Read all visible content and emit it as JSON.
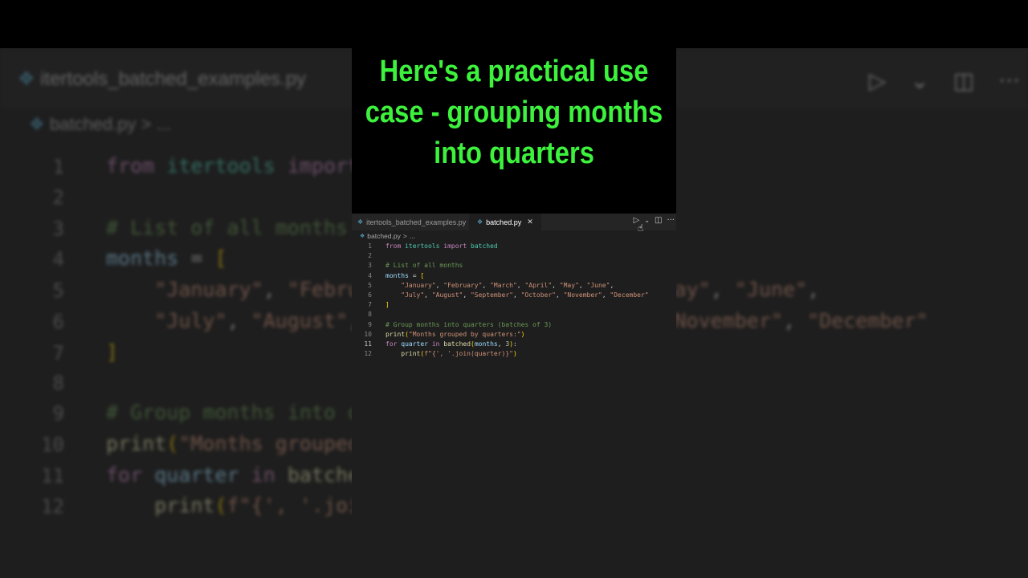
{
  "caption": "Here's a practical use case - grouping months into quarters",
  "tabs": [
    {
      "label": "itertools_batched_examples.py",
      "active": false
    },
    {
      "label": "batched.py",
      "active": true
    }
  ],
  "tab_close_glyph": "✕",
  "breadcrumb": {
    "file": "batched.py",
    "separator": ">",
    "rest": "..."
  },
  "actions": {
    "run": "▷",
    "dropdown": "⌄",
    "split": "◫",
    "more": "···"
  },
  "editor": {
    "current_line": 11,
    "lines": [
      {
        "n": "1",
        "tokens": [
          [
            "k",
            "from"
          ],
          [
            "p",
            " "
          ],
          [
            "n",
            "itertools"
          ],
          [
            "p",
            " "
          ],
          [
            "k",
            "import"
          ],
          [
            "p",
            " "
          ],
          [
            "n",
            "batched"
          ]
        ]
      },
      {
        "n": "2",
        "tokens": []
      },
      {
        "n": "3",
        "tokens": [
          [
            "c",
            "# List of all months"
          ]
        ]
      },
      {
        "n": "4",
        "tokens": [
          [
            "v",
            "months"
          ],
          [
            "p",
            " = "
          ],
          [
            "b",
            "["
          ]
        ]
      },
      {
        "n": "5",
        "tokens": [
          [
            "p",
            "    "
          ],
          [
            "s",
            "\"January\""
          ],
          [
            "p",
            ", "
          ],
          [
            "s",
            "\"February\""
          ],
          [
            "p",
            ", "
          ],
          [
            "s",
            "\"March\""
          ],
          [
            "p",
            ", "
          ],
          [
            "s",
            "\"April\""
          ],
          [
            "p",
            ", "
          ],
          [
            "s",
            "\"May\""
          ],
          [
            "p",
            ", "
          ],
          [
            "s",
            "\"June\""
          ],
          [
            "p",
            ","
          ]
        ]
      },
      {
        "n": "6",
        "tokens": [
          [
            "p",
            "    "
          ],
          [
            "s",
            "\"July\""
          ],
          [
            "p",
            ", "
          ],
          [
            "s",
            "\"August\""
          ],
          [
            "p",
            ", "
          ],
          [
            "s",
            "\"September\""
          ],
          [
            "p",
            ", "
          ],
          [
            "s",
            "\"October\""
          ],
          [
            "p",
            ", "
          ],
          [
            "s",
            "\"November\""
          ],
          [
            "p",
            ", "
          ],
          [
            "s",
            "\"December\""
          ]
        ]
      },
      {
        "n": "7",
        "tokens": [
          [
            "b",
            "]"
          ]
        ]
      },
      {
        "n": "8",
        "tokens": []
      },
      {
        "n": "9",
        "tokens": [
          [
            "c",
            "# Group months into quarters (batches of 3)"
          ]
        ]
      },
      {
        "n": "10",
        "tokens": [
          [
            "f",
            "print"
          ],
          [
            "b",
            "("
          ],
          [
            "s",
            "\"Months grouped by quarters:\""
          ],
          [
            "b",
            ")"
          ]
        ]
      },
      {
        "n": "11",
        "tokens": [
          [
            "k",
            "for"
          ],
          [
            "p",
            " "
          ],
          [
            "v",
            "quarter"
          ],
          [
            "p",
            " "
          ],
          [
            "k",
            "in"
          ],
          [
            "p",
            " "
          ],
          [
            "f",
            "batched"
          ],
          [
            "b",
            "("
          ],
          [
            "v",
            "months"
          ],
          [
            "p",
            ", "
          ],
          [
            "num",
            "3"
          ],
          [
            "b",
            ")"
          ],
          [
            "p",
            ":"
          ]
        ]
      },
      {
        "n": "12",
        "tokens": [
          [
            "p",
            "    "
          ],
          [
            "f",
            "print"
          ],
          [
            "b",
            "("
          ],
          [
            "s",
            "f\"{', '.join(quarter)}\""
          ],
          [
            "b",
            ")"
          ]
        ]
      }
    ]
  },
  "colors": {
    "caption": "#3df23d",
    "background": "#1e1e1e"
  }
}
